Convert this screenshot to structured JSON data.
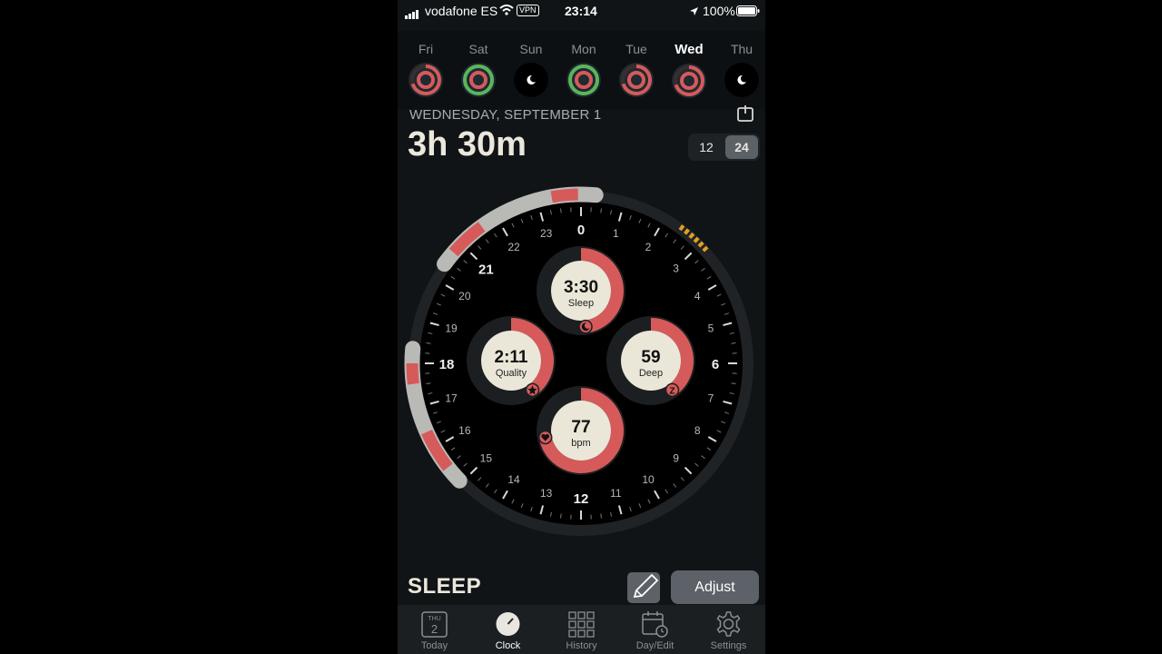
{
  "status_bar": {
    "carrier": "vodafone ES",
    "vpn": "VPN",
    "time": "23:14",
    "battery": "100%"
  },
  "days": [
    {
      "label": "Fri",
      "ring_color": "#d65a5a",
      "selected": false
    },
    {
      "label": "Sat",
      "ring_color": "#5ab55c",
      "selected": false
    },
    {
      "label": "Sun",
      "ring_color": "",
      "selected": false
    },
    {
      "label": "Mon",
      "ring_color": "#5ab55c",
      "selected": false
    },
    {
      "label": "Tue",
      "ring_color": "#d65a5a",
      "selected": false
    },
    {
      "label": "Wed",
      "ring_color": "#d65a5a",
      "selected": true
    },
    {
      "label": "Thu",
      "ring_color": "",
      "selected": false
    }
  ],
  "header": {
    "date": "WEDNESDAY, SEPTEMBER 1",
    "duration": "3h 30m"
  },
  "format_toggle": {
    "option_12": "12",
    "option_24": "24",
    "selected": "24"
  },
  "dial": {
    "hour_labels": [
      "0",
      "1",
      "2",
      "3",
      "4",
      "5",
      "6",
      "7",
      "8",
      "9",
      "10",
      "11",
      "12",
      "13",
      "14",
      "15",
      "16",
      "17",
      "18",
      "19",
      "20",
      "21",
      "22",
      "23"
    ],
    "metrics": {
      "sleep": {
        "value": "3:30",
        "label": "Sleep",
        "fill": 0.48
      },
      "quality": {
        "value": "2:11",
        "label": "Quality",
        "fill": 0.4
      },
      "deep": {
        "value": "59",
        "label": "Deep",
        "fill": 0.4
      },
      "bpm": {
        "value": "77",
        "label": "bpm",
        "fill": 0.72
      }
    },
    "colors": {
      "accent": "#d65a5a",
      "track": "#b9bab6",
      "dial": "#000000",
      "awake": "#e0a020"
    }
  },
  "footer": {
    "title": "SLEEP",
    "adjust_label": "Adjust"
  },
  "tabbar": {
    "today_badge_day": "THU",
    "today_badge_num": "2",
    "tabs": [
      {
        "label": "Today",
        "icon": "calendar-day-icon"
      },
      {
        "label": "Clock",
        "icon": "clock-icon"
      },
      {
        "label": "History",
        "icon": "grid-icon"
      },
      {
        "label": "Day/Edit",
        "icon": "calendar-edit-icon"
      },
      {
        "label": "Settings",
        "icon": "gear-icon"
      }
    ],
    "active": "Clock"
  }
}
